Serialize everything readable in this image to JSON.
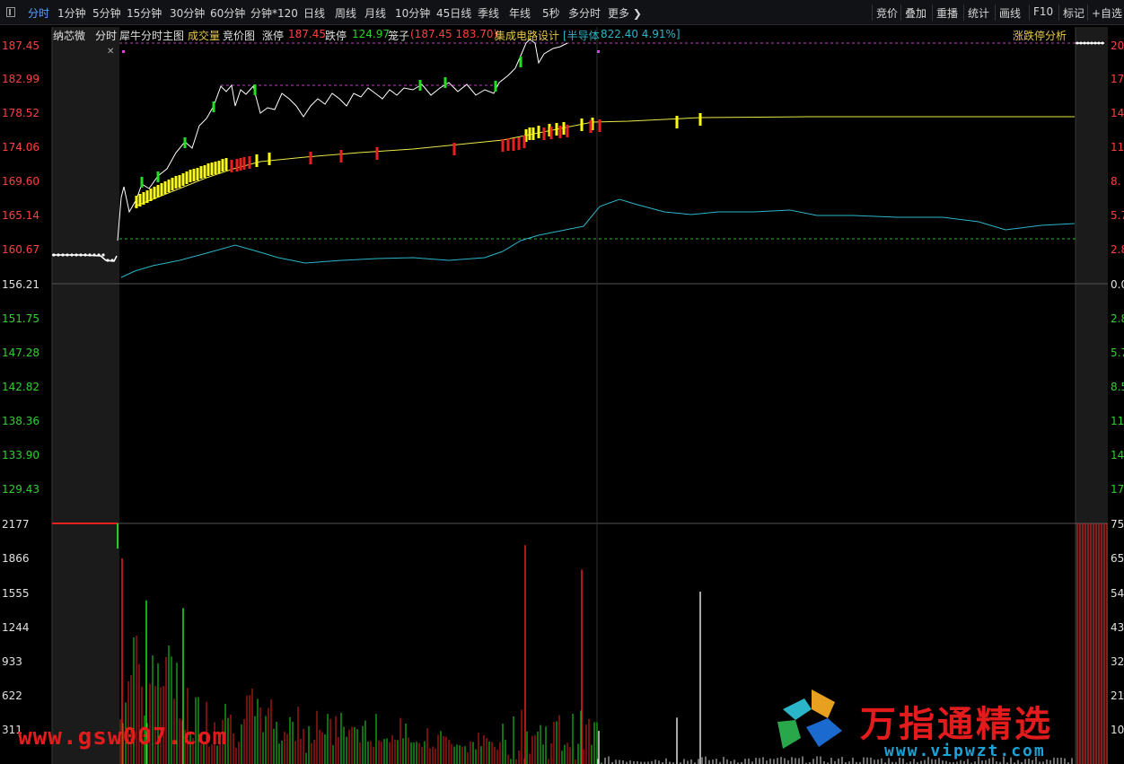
{
  "toolbar": {
    "tabs": [
      "分时",
      "1分钟",
      "5分钟",
      "15分钟",
      "30分钟",
      "60分钟",
      "分钟*120",
      "日线",
      "周线",
      "月线",
      "10分钟",
      "45日线",
      "季线",
      "年线",
      "5秒",
      "多分时",
      "更多 ❯"
    ],
    "right": [
      "竞价",
      "叠加",
      "重播",
      "统计",
      "画线",
      "F10",
      "标记",
      "+自选"
    ]
  },
  "info": {
    "stock_name": "纳芯微",
    "mode": "分时",
    "main_indicator": "犀牛分时主图",
    "volume_label": "成交量",
    "auction_label": "竞价图",
    "limit_up_label": "涨停",
    "limit_up_value": "187.45",
    "limit_down_label": "跌停",
    "limit_down_value": "124.97",
    "cage_label": "笼子",
    "cage_value": "(187.45 183.70)",
    "sector": "集成电路设计",
    "index_label": "[半导体",
    "index_value": "822.40 4.91%]",
    "analysis": "涨跌停分析"
  },
  "close_glyph": "✕",
  "axes": {
    "price_ticks": [
      "187.45",
      "182.99",
      "178.52",
      "174.06",
      "169.60",
      "165.14",
      "160.67",
      "156.21",
      "151.75",
      "147.28",
      "142.82",
      "138.36",
      "133.90",
      "129.43"
    ],
    "pct_ticks": [
      "20",
      "17",
      "14",
      "11",
      "8.",
      "5.7",
      "2.8",
      "0.0",
      "2.8",
      "5.7",
      "8.5",
      "11",
      "14",
      "17"
    ],
    "vol_ticks": [
      "2177",
      "1866",
      "1555",
      "1244",
      "933",
      "622",
      "311"
    ],
    "vol_right_ticks": [
      "75",
      "65",
      "54",
      "43",
      "32",
      "21",
      "10"
    ]
  },
  "colors": {
    "up": "#ff3232",
    "down": "#28c828",
    "price_line": "#ffffff",
    "avg_line": "#e8e84a",
    "index_line": "#2bb5c8",
    "bar_yellow": "#ffff00",
    "bar_green": "#20e020",
    "bar_red": "#e82020",
    "vol_white": "#dddddd"
  },
  "watermarks": {
    "left": "www.gsw007.com",
    "brand": "万指通精选",
    "brand_url": "www.vipwzt.com"
  },
  "chart_data": {
    "type": "line",
    "title": "",
    "y_range": [
      124.97,
      187.45
    ],
    "prev_close": 156.21,
    "price_series_note": "intraday price path",
    "price": [
      160.67,
      160.6,
      160.4,
      163.0,
      166.5,
      169.6,
      171.0,
      174.2,
      176.5,
      179.5,
      181.6,
      182.2,
      181.4,
      180.8,
      180.0,
      181.3,
      182.0,
      181.5,
      182.3,
      182.5,
      182.8,
      183.2,
      187.2,
      186.8,
      187.45
    ],
    "avg": [
      166.2,
      167.6,
      169.0,
      170.3,
      171.4,
      172.2,
      172.7,
      173.1,
      173.6,
      174.1,
      174.7,
      175.6,
      176.3,
      176.6,
      176.6,
      176.7,
      176.8,
      176.8
    ],
    "volume_ylim": [
      0,
      2177
    ],
    "volume_peaks": [
      1860,
      1480,
      1410,
      1980,
      1760,
      1560
    ]
  }
}
